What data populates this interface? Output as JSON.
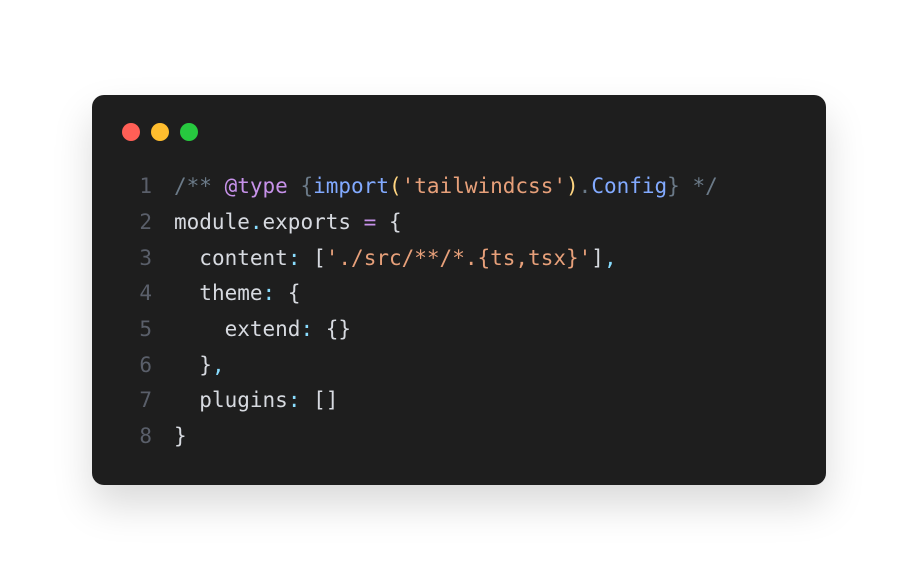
{
  "window": {
    "controls": [
      "close",
      "minimize",
      "maximize"
    ]
  },
  "code": {
    "lineNumbers": [
      "1",
      "2",
      "3",
      "4",
      "5",
      "6",
      "7",
      "8"
    ],
    "line1": {
      "commentOpen": "/** ",
      "tag": "@type",
      "space": " ",
      "braceOpen": "{",
      "import": "import",
      "parenOpen": "(",
      "string": "'tailwindcss'",
      "parenClose": ")",
      "dot": ".",
      "config": "Config",
      "braceClose": "}",
      "commentClose": " */"
    },
    "line2": {
      "module": "module",
      "dot": ".",
      "exports": "exports",
      "equals": " = ",
      "braceOpen": "{"
    },
    "line3": {
      "indent": "  ",
      "key": "content",
      "colon": ": ",
      "bracketOpen": "[",
      "string": "'./src/**/*.{ts,tsx}'",
      "bracketClose": "]",
      "comma": ","
    },
    "line4": {
      "indent": "  ",
      "key": "theme",
      "colon": ": ",
      "braceOpen": "{"
    },
    "line5": {
      "indent": "    ",
      "key": "extend",
      "colon": ": ",
      "braces": "{}"
    },
    "line6": {
      "indent": "  ",
      "braceClose": "}",
      "comma": ","
    },
    "line7": {
      "indent": "  ",
      "key": "plugins",
      "colon": ": ",
      "brackets": "[]"
    },
    "line8": {
      "braceClose": "}"
    }
  }
}
